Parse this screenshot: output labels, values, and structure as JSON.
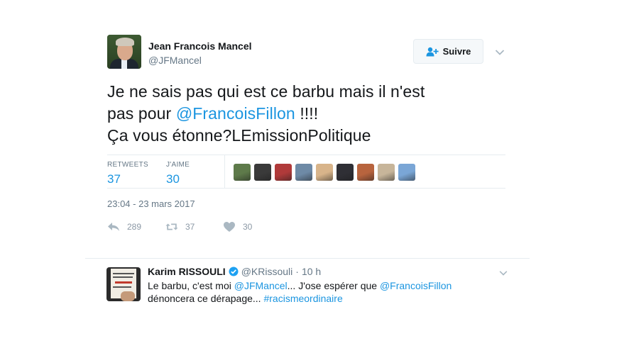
{
  "tweet": {
    "author": {
      "name": "Jean Francois Mancel",
      "handle": "@JFMancel"
    },
    "follow_label": "Suivre",
    "text": {
      "line1": "Je ne sais pas qui est ce barbu mais il n'est",
      "line2_before": "pas pour ",
      "line2_mention": "@FrancoisFillon",
      "line2_after": " !!!!",
      "line3": "Ça vous étonne?LEmissionPolitique"
    },
    "stats": {
      "retweets_label": "RETWEETS",
      "retweets_value": "37",
      "likes_label": "J'AIME",
      "likes_value": "30"
    },
    "likers": [
      "#5e7a4a",
      "#3a3a3a",
      "#b03a3a",
      "#6e8aa6",
      "#d8b48a",
      "#2f2f35",
      "#b8643e",
      "#c7b59a",
      "#7aa6d6"
    ],
    "timestamp": "23:04 - 23 mars 2017",
    "actions": {
      "reply_count": "289",
      "retweet_count": "37",
      "like_count": "30"
    }
  },
  "reply": {
    "name": "Karim RISSOULI",
    "handle": "@KRissouli",
    "dot": "·",
    "time": "10 h",
    "text": {
      "part1": "Le barbu, c'est moi ",
      "mention1": "@JFMancel",
      "part2": "... J'ose espérer que ",
      "mention2": "@FrancoisFillon",
      "part3": "dénoncera ce dérapage... ",
      "hashtag": "#racismeordinaire"
    }
  },
  "colors": {
    "link": "#1b95e0",
    "text": "#14171a",
    "muted": "#657786",
    "border": "#e6ecf0"
  }
}
